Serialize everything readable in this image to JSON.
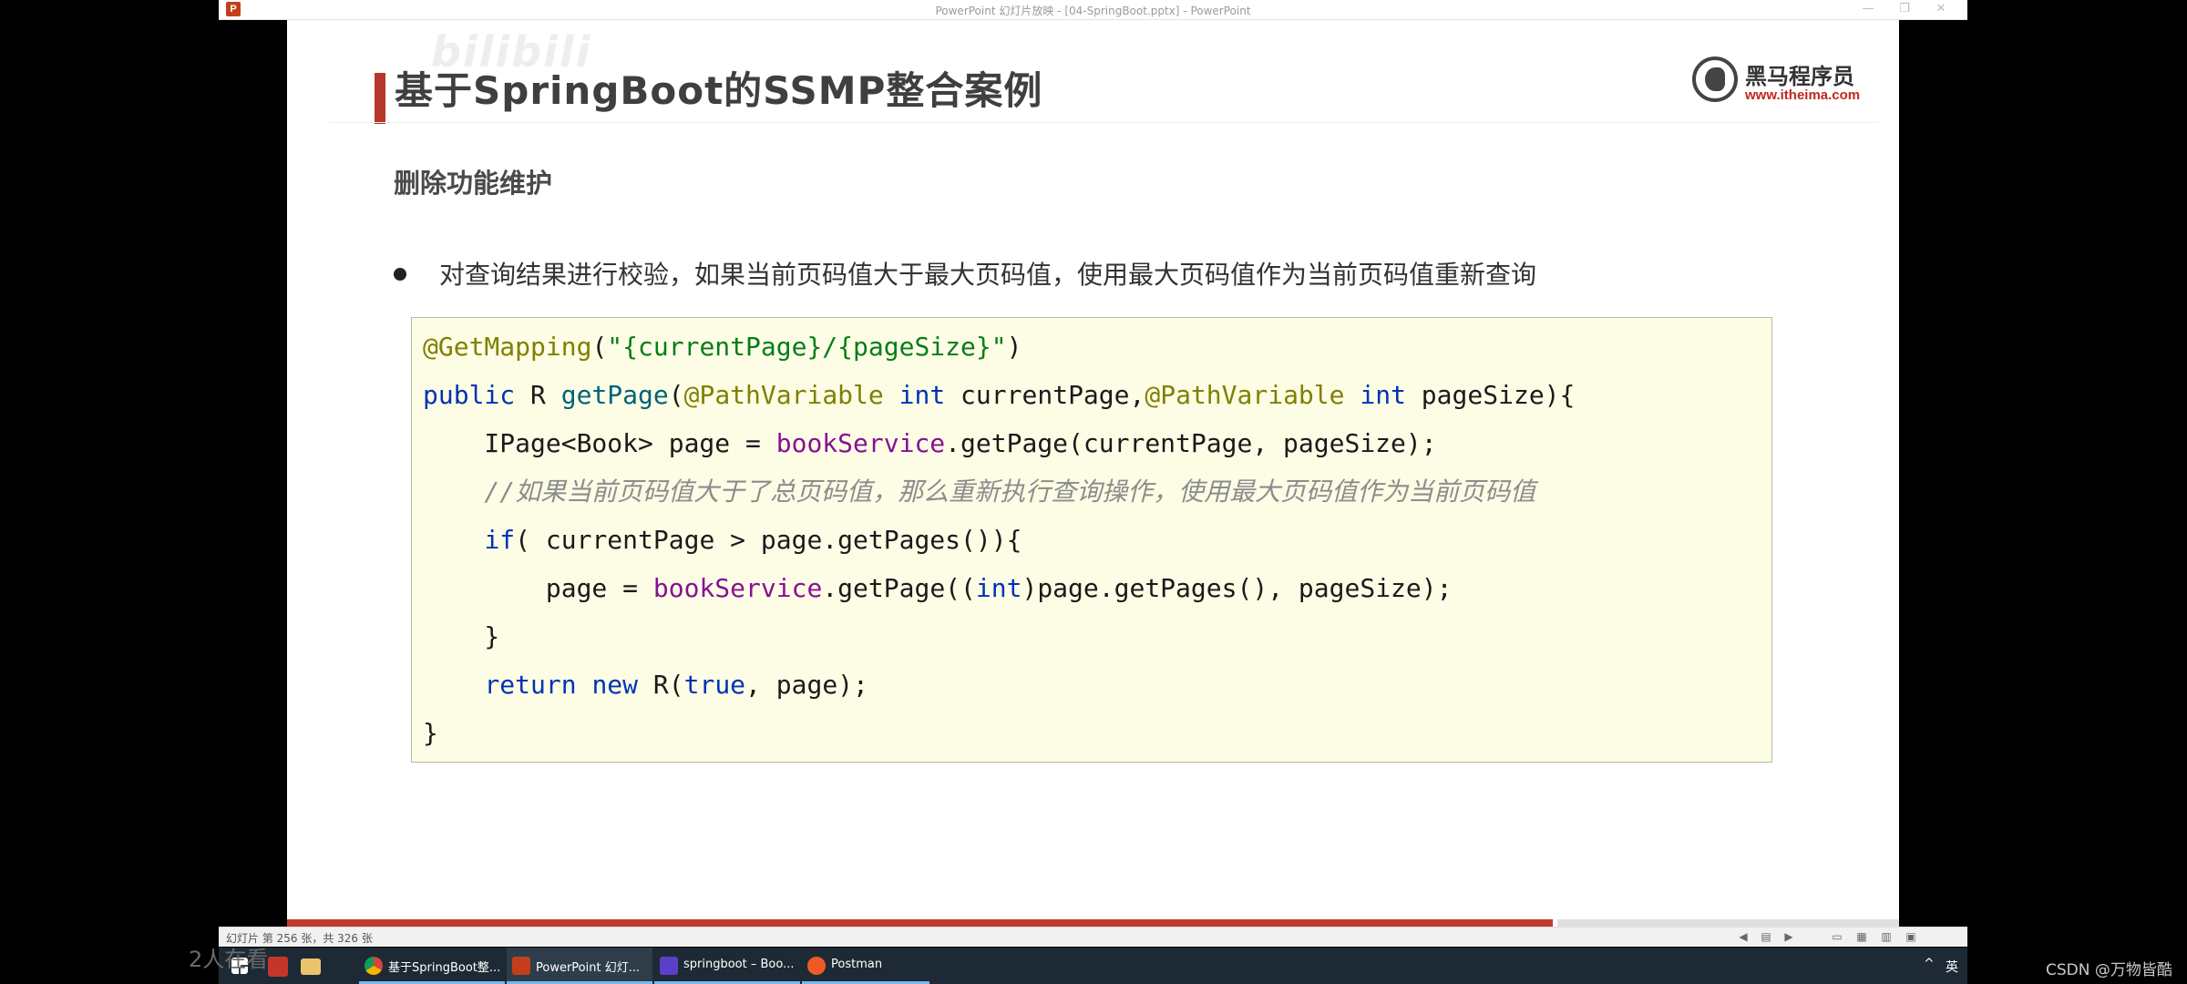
{
  "window": {
    "title": "PowerPoint 幻灯片放映 - [04-SpringBoot.pptx] - PowerPoint",
    "app_icon": "P",
    "controls": {
      "minimize": "—",
      "maximize": "❐",
      "close": "✕"
    }
  },
  "slide": {
    "title": "基于SpringBoot的SSMP整合案例",
    "watermark_left": "黑",
    "watermark_bilibili": "bilibili",
    "logo": {
      "name": "黑马程序员",
      "url": "www.itheima.com"
    },
    "subtitle": "删除功能维护",
    "bullet": "对查询结果进行校验，如果当前页码值大于最大页码值，使用最大页码值作为当前页码值重新查询",
    "code": {
      "l1_ann": "@GetMapping",
      "l1_p1": "(",
      "l1_str": "\"{currentPage}/{pageSize}\"",
      "l1_p2": ")",
      "l2_kw": "public",
      "l2_t1": " R ",
      "l2_fn": "getPage",
      "l2_t2": "(",
      "l2_ann1": "@PathVariable",
      "l2_sp1": " ",
      "l2_kw1": "int",
      "l2_t3": " currentPage,",
      "l2_ann2": "@PathVariable",
      "l2_sp2": " ",
      "l2_kw2": "int",
      "l2_t4": " pageSize){",
      "l3_t1": "    IPage<Book> page = ",
      "l3_fld": "bookService",
      "l3_t2": ".getPage(currentPage, pageSize);",
      "l4_cmt": "    //如果当前页码值大于了总页码值，那么重新执行查询操作，使用最大页码值作为当前页码值",
      "l5_sp": "    ",
      "l5_kw": "if",
      "l5_t1": "( currentPage > page.getPages()){",
      "l6_t1": "        page = ",
      "l6_fld": "bookService",
      "l6_t2": ".getPage((",
      "l6_kw": "int",
      "l6_t3": ")page.getPages(), pageSize);",
      "l7_t1": "    }",
      "l8_sp": "    ",
      "l8_kw1": "return",
      "l8_sp2": " ",
      "l8_kw2": "new",
      "l8_t1": " R(",
      "l8_kw3": "true",
      "l8_t2": ", page);",
      "l9_t1": "}"
    },
    "progress": 0.785
  },
  "statusbar": {
    "slide_counter": "幻灯片 第 256 张，共 326 张",
    "icons": [
      "prev-icon",
      "notes-icon",
      "next-icon",
      "normal-view-icon",
      "sorter-view-icon",
      "reading-view-icon",
      "slideshow-icon"
    ]
  },
  "taskbar": {
    "apps": [
      {
        "label": "基于SpringBoot整...",
        "icon": "chrome-icon",
        "color": "#e8b64a"
      },
      {
        "label": "PowerPoint 幻灯...",
        "icon": "powerpoint-icon",
        "color": "#c43e1c"
      },
      {
        "label": "springboot – Boo...",
        "icon": "intellij-icon",
        "color": "#5c3fc9"
      },
      {
        "label": "Postman",
        "icon": "postman-icon",
        "color": "#ef5b25"
      }
    ],
    "tray": {
      "chevron": "^",
      "ime": "英"
    }
  },
  "overlay": {
    "viewers": "2人在看",
    "csdn": "CSDN @万物皆酷"
  }
}
